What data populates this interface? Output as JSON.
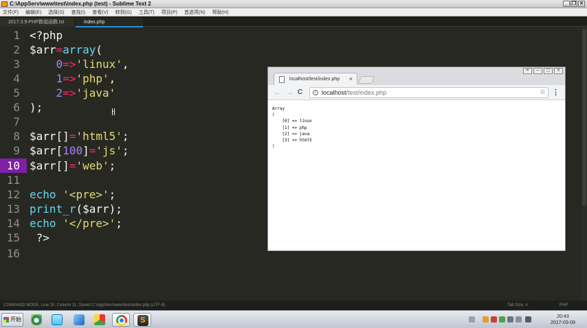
{
  "sublime": {
    "window_title": "C:\\AppServ\\www\\test\\index.php (test) - Sublime Text 2",
    "window_buttons": [
      "_",
      "❐",
      "✕"
    ],
    "menu": [
      "文件(F)",
      "编辑(E)",
      "选择(S)",
      "查找(I)",
      "查看(V)",
      "转到(G)",
      "工具(T)",
      "项目(P)",
      "首选项(N)",
      "帮助(H)"
    ],
    "tabs": [
      {
        "label": "2017.3.9-PHP数组函数.txt"
      },
      {
        "label": "index.php"
      }
    ],
    "active_line": 10,
    "line_numbers": [
      "1",
      "2",
      "3",
      "4",
      "5",
      "6",
      "7",
      "8",
      "9",
      "10",
      "11",
      "12",
      "13",
      "14",
      "15",
      "16"
    ],
    "code_lines": [
      "<?php",
      "$arr=array(",
      "    0=>'linux',",
      "    1=>'php',",
      "    2=>'java'",
      ");",
      "",
      "$arr[]='html5';",
      "$arr[100]='js';",
      "$arr[]='web';",
      "",
      "echo '<pre>';",
      "print_r($arr);",
      "echo '</pre>';",
      " ?>",
      ""
    ],
    "status_left": "COMMAND MODE, Line 10, Column 11; Saved C:\\AppServ\\www\\test\\index.php (UTF-8)",
    "status_tab_size": "Tab Size: 4",
    "status_syntax": "PHP",
    "syntax_colors": {
      "background": "#272822",
      "keyword": "#f92672",
      "function": "#66d9ef",
      "string": "#e6db74",
      "number": "#ae81ff",
      "active_line": "#7f1fa6"
    }
  },
  "browser": {
    "tab_label": "localhost/test/index.php",
    "tab_close": "×",
    "url_host": "localhost",
    "url_path": "/test/index.php",
    "nav": {
      "back": "←",
      "forward": "→",
      "reload": "C"
    },
    "star": "☆",
    "menu": "⋮",
    "window_buttons": [
      "≗",
      "—",
      "▢",
      "✕"
    ],
    "output": "Array\n(\n    [0] => linux\n    [1] => php\n    [2] => java\n    [3] => html5\n)"
  },
  "taskbar": {
    "start_label": "开始",
    "apps": [
      "ie-icon",
      "chat-icon",
      "tools-icon",
      "color-icon",
      "chrome-icon",
      "sublime-icon"
    ],
    "clock_time": "20:43",
    "clock_date": "2017-03-09"
  }
}
